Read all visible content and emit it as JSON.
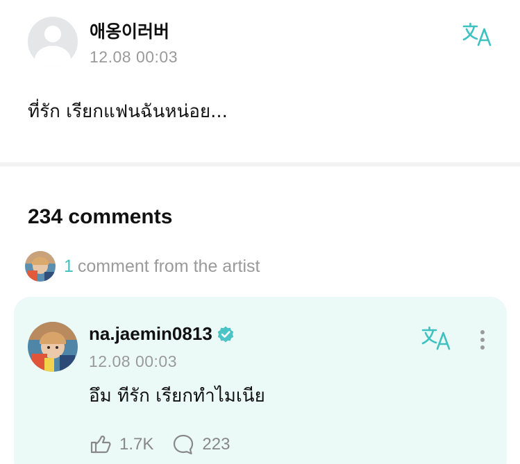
{
  "post": {
    "author": "애옹이러버",
    "time": "12.08 00:03",
    "body": "ที่รัก เรียกแฟนฉันหน่อย..."
  },
  "comments": {
    "title": "234 comments",
    "artist_count": "1",
    "artist_text": "comment from the artist"
  },
  "artist_comment": {
    "author": "na.jaemin0813",
    "time": "12.08 00:03",
    "body": "อึม ทีรัก เรียกทำไมเนีย",
    "likes": "1.7K",
    "replies": "223"
  },
  "icons": {
    "translate": "translate-icon",
    "verified": "verified-badge-icon",
    "more": "more-vertical-icon",
    "like": "hand-heart-icon",
    "reply": "speech-bubble-icon"
  },
  "colors": {
    "accent": "#3fc1c0",
    "card_bg": "#ebf9f7",
    "muted_text": "#9a9a9a"
  }
}
